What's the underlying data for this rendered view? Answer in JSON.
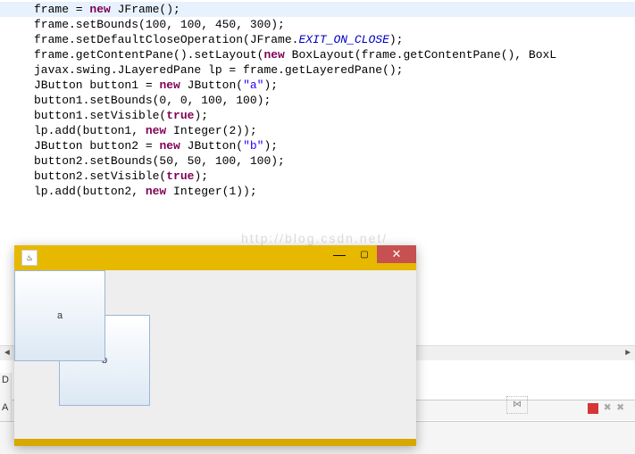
{
  "code": {
    "lines": [
      {
        "pre": "frame = ",
        "kw1": "new",
        "mid1": " JFrame();",
        "tail": ""
      },
      {
        "pre": "frame.setBounds(100, 100, 450, 300);"
      },
      {
        "pre": "frame.setDefaultCloseOperation(JFrame.",
        "static": "EXIT_ON_CLOSE",
        "post": ");"
      },
      {
        "pre": "frame.getContentPane().setLayout(",
        "kw1": "new",
        "mid1": " BoxLayout(frame.getContentPane(), BoxL"
      },
      {
        "pre": "javax.swing.JLayeredPane lp = frame.getLayeredPane();"
      },
      {
        "pre": "JButton button1 = ",
        "kw1": "new",
        "mid1": " JButton(",
        "str": "\"a\"",
        "post": ");"
      },
      {
        "pre": "button1.setBounds(0, 0, 100, 100);"
      },
      {
        "pre": "button1.setVisible(",
        "kw1": "true",
        "post": ");"
      },
      {
        "pre": "lp.add(button1, ",
        "kw1": "new",
        "mid1": " Integer(2));"
      },
      {
        "pre": "JButton button2 = ",
        "kw1": "new",
        "mid1": " JButton(",
        "str": "\"b\"",
        "post": ");"
      },
      {
        "pre": "button2.setBounds(50, 50, 100, 100);"
      },
      {
        "pre": "button2.setVisible(",
        "kw1": "true",
        "post": ");"
      },
      {
        "pre": "lp.add(button2, ",
        "kw1": "new",
        "mid1": " Integer(1));"
      }
    ]
  },
  "watermark": "http://blog.csdn.net/",
  "gutter": {
    "d": "D",
    "a": "A"
  },
  "tabctrl": "⋈",
  "jframe": {
    "java_icon": "♨",
    "min": "—",
    "max": "▢",
    "close": "✕",
    "button_a": "a",
    "button_b": "b"
  }
}
